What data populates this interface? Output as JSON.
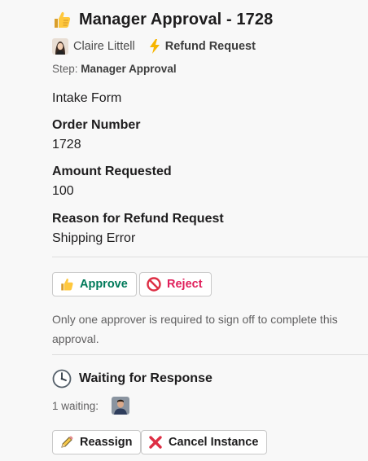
{
  "header": {
    "title_icon": "thumbs-up-icon",
    "title": "Manager Approval - 1728",
    "requester_name": "Claire Littell",
    "workflow_icon": "lightning-bolt-icon",
    "workflow_name": "Refund Request",
    "step_label": "Step:",
    "step_value": "Manager Approval"
  },
  "form": {
    "form_title": "Intake Form",
    "fields": [
      {
        "label": "Order Number",
        "value": "1728"
      },
      {
        "label": "Amount Requested",
        "value": "100"
      },
      {
        "label": "Reason for Refund Request",
        "value": "Shipping Error"
      }
    ]
  },
  "actions": {
    "approve_label": "Approve",
    "approve_icon": "thumbs-up-icon",
    "reject_label": "Reject",
    "reject_icon": "no-entry-icon",
    "note": "Only one approver is required to sign off to complete this approval."
  },
  "status": {
    "icon": "clock-icon",
    "title": "Waiting for Response",
    "waiting_count": "1 waiting:",
    "reassign_label": "Reassign",
    "reassign_icon": "pencil-icon",
    "cancel_label": "Cancel Instance",
    "cancel_icon": "red-x-icon"
  },
  "colors": {
    "approve": "#007a5a",
    "reject": "#e01e5a",
    "background": "#f8f8f8"
  }
}
